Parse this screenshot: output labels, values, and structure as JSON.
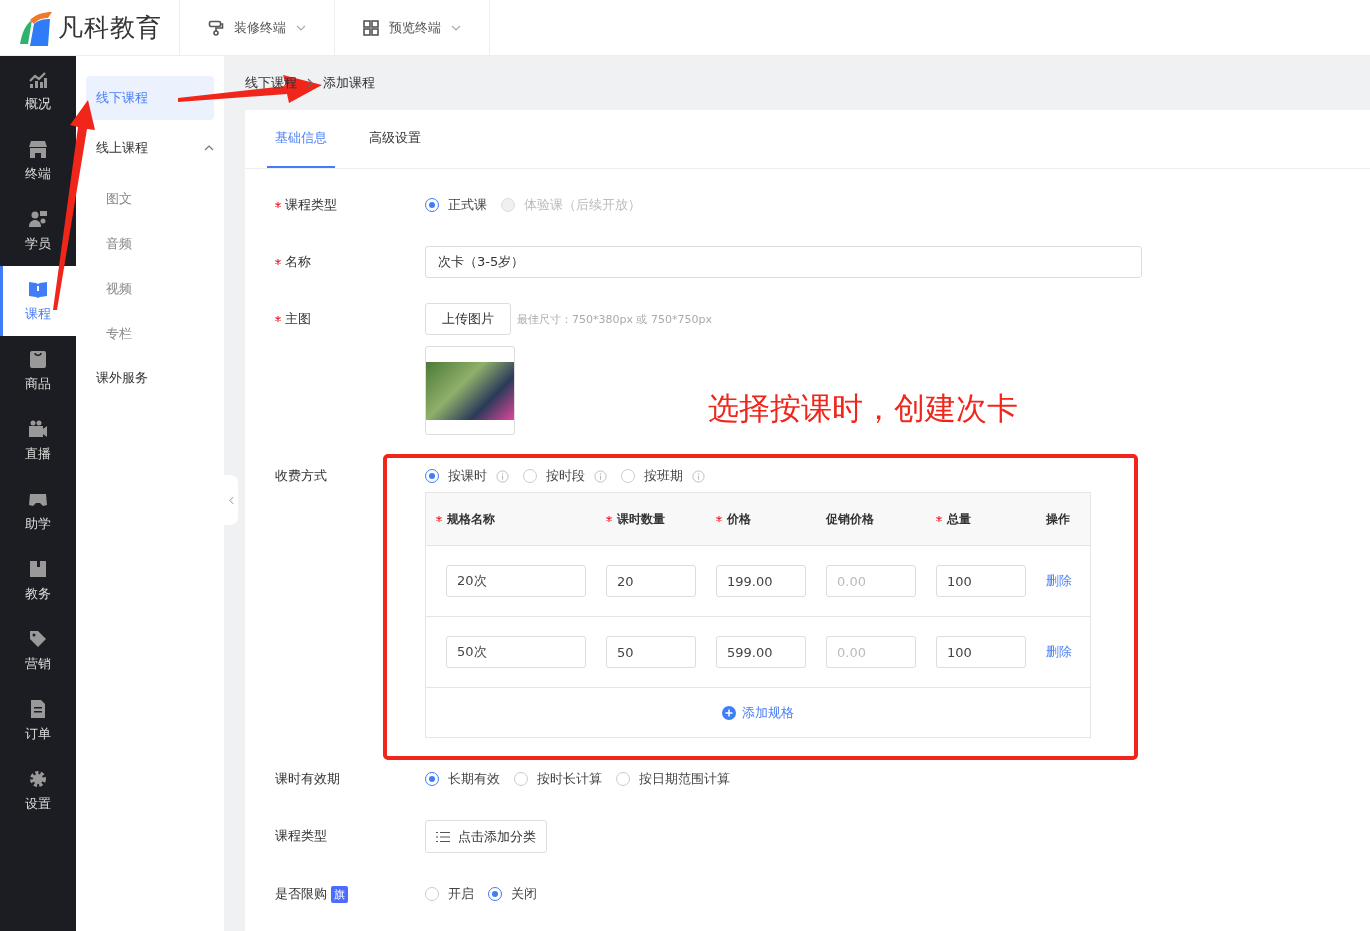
{
  "logo": {
    "text": "凡科教育"
  },
  "top_menu": [
    {
      "label": "装修终端"
    },
    {
      "label": "预览终端"
    }
  ],
  "nav": [
    {
      "label": "概况",
      "selected": false
    },
    {
      "label": "终端",
      "selected": false
    },
    {
      "label": "学员",
      "selected": false
    },
    {
      "label": "课程",
      "selected": true
    },
    {
      "label": "商品",
      "selected": false
    },
    {
      "label": "直播",
      "selected": false
    },
    {
      "label": "助学",
      "selected": false
    },
    {
      "label": "教务",
      "selected": false
    },
    {
      "label": "营销",
      "selected": false
    },
    {
      "label": "订单",
      "selected": false
    },
    {
      "label": "设置",
      "selected": false
    }
  ],
  "submenu": [
    {
      "label": "线下课程",
      "selected": true
    },
    {
      "label": "线上课程",
      "selected": false,
      "expanded": true,
      "children": [
        {
          "label": "图文",
          "selected": false
        },
        {
          "label": "音频",
          "selected": false
        },
        {
          "label": "视频",
          "selected": false
        },
        {
          "label": "专栏",
          "selected": false
        }
      ]
    },
    {
      "label": "课外服务",
      "selected": false
    }
  ],
  "breadcrumb": [
    "线下课程",
    "添加课程"
  ],
  "tabs": [
    {
      "label": "基础信息",
      "selected": true
    },
    {
      "label": "高级设置",
      "selected": false
    }
  ],
  "fields": [
    {
      "kind": "radio",
      "label": "课程类型",
      "required": true,
      "options": [
        {
          "label": "正式课",
          "selected": true,
          "disabled": false
        },
        {
          "label": "体验课（后续开放）",
          "selected": false,
          "disabled": true
        }
      ]
    },
    {
      "kind": "text",
      "label": "名称",
      "required": true,
      "value": "次卡（3-5岁）"
    },
    {
      "kind": "upload",
      "label": "主图",
      "required": true,
      "button": "上传图片",
      "hint": "最佳尺寸：750*380px 或 750*750px"
    },
    {
      "kind": "charge",
      "label": "收费方式",
      "options": [
        {
          "label": "按课时",
          "selected": true,
          "disabled": false
        },
        {
          "label": "按时段",
          "selected": false,
          "disabled": false
        },
        {
          "label": "按班期",
          "selected": false,
          "disabled": false
        }
      ],
      "table": {
        "columns": [
          {
            "label": "规格名称",
            "required": true
          },
          {
            "label": "课时数量",
            "required": true
          },
          {
            "label": "价格",
            "required": true
          },
          {
            "label": "促销价格",
            "required": false
          },
          {
            "label": "总量",
            "required": true
          },
          {
            "label": "操作",
            "required": false
          }
        ],
        "rows": [
          {
            "name": "20次",
            "count": "20",
            "price": "199.00",
            "promo_placeholder": "0.00",
            "total": "100",
            "action": "删除"
          },
          {
            "name": "50次",
            "count": "50",
            "price": "599.00",
            "promo_placeholder": "0.00",
            "total": "100",
            "action": "删除"
          }
        ],
        "add_label": "添加规格"
      }
    },
    {
      "kind": "radio",
      "label": "课时有效期",
      "options": [
        {
          "label": "长期有效",
          "selected": true,
          "disabled": false
        },
        {
          "label": "按时长计算",
          "selected": false,
          "disabled": false
        },
        {
          "label": "按日期范围计算",
          "selected": false,
          "disabled": false
        }
      ]
    },
    {
      "kind": "picker",
      "label": "课程类型",
      "button": "点击添加分类"
    },
    {
      "kind": "radio",
      "label": "是否限购",
      "badge": "旗",
      "options": [
        {
          "label": "开启",
          "selected": false,
          "disabled": false
        },
        {
          "label": "关闭",
          "selected": true,
          "disabled": false
        }
      ]
    }
  ],
  "annotation": {
    "text": "选择按课时，创建次卡"
  }
}
